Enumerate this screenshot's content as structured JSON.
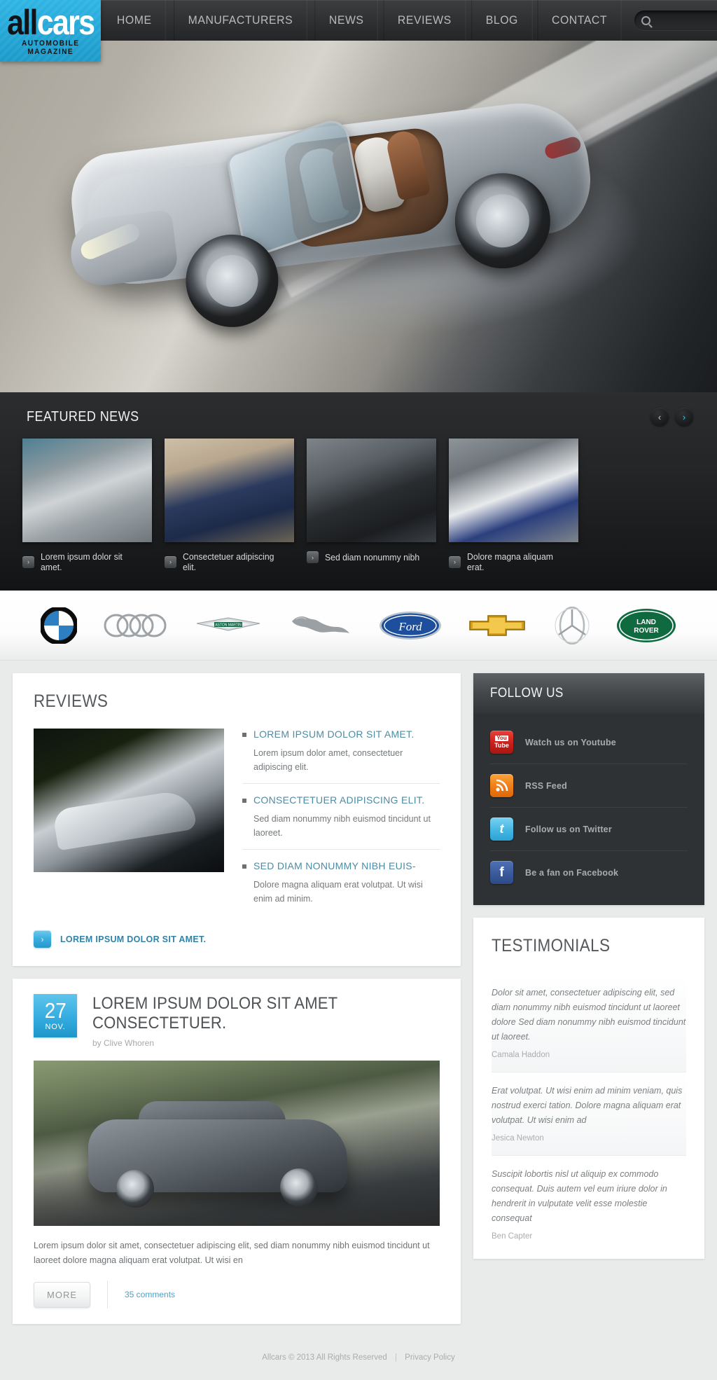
{
  "site": {
    "logo_primary": "all",
    "logo_secondary": "cars",
    "logo_tagline": "AUTOMOBILE MAGAZINE",
    "accent_color": "#29a8d6",
    "link_color": "#4e8ba3"
  },
  "nav": {
    "items": [
      {
        "label": "HOME"
      },
      {
        "label": "MANUFACTURERS"
      },
      {
        "label": "NEWS"
      },
      {
        "label": "REVIEWS"
      },
      {
        "label": "BLOG"
      },
      {
        "label": "CONTACT"
      }
    ],
    "search": {
      "placeholder": "",
      "value": "",
      "icon": "search-icon"
    }
  },
  "featured": {
    "title": "FEATURED NEWS",
    "prev_icon": "‹",
    "next_icon": "›",
    "item_icon": "›",
    "items": [
      {
        "caption": "Lorem ipsum dolor sit amet."
      },
      {
        "caption": "Consectetuer adipiscing elit."
      },
      {
        "caption": "Sed diam nonummy nibh"
      },
      {
        "caption": "Dolore magna aliquam erat."
      }
    ]
  },
  "brands": [
    {
      "name": "BMW"
    },
    {
      "name": "Audi"
    },
    {
      "name": "Aston Martin"
    },
    {
      "name": "Jaguar"
    },
    {
      "name": "Ford"
    },
    {
      "name": "Chevrolet"
    },
    {
      "name": "Mercedes-Benz"
    },
    {
      "name": "Land Rover"
    }
  ],
  "reviews": {
    "title": "REVIEWS",
    "items": [
      {
        "title": "LOREM IPSUM DOLOR SIT AMET.",
        "description": "Lorem ipsum dolor amet, consectetuer adipiscing elit."
      },
      {
        "title": "CONSECTETUER ADIPISCING ELIT.",
        "description": "Sed diam nonummy nibh euismod tincidunt ut laoreet."
      },
      {
        "title": "SED DIAM NONUMMY NIBH EUIS-",
        "description": "Dolore magna aliquam erat volutpat. Ut wisi enim ad minim."
      }
    ],
    "more_label": "LOREM IPSUM DOLOR SIT AMET.",
    "more_icon": "›"
  },
  "post": {
    "date_day": "27",
    "date_month": "NOV.",
    "title": "LOREM IPSUM DOLOR SIT AMET CONSECTETUER.",
    "author": "by Clive Whoren",
    "body": "Lorem ipsum dolor sit amet, consectetuer adipiscing elit, sed diam nonummy nibh euismod tincidunt ut laoreet dolore magna aliquam erat volutpat. Ut wisi en",
    "more_label": "MORE",
    "comments_label": "35 comments"
  },
  "follow": {
    "title": "FOLLOW US",
    "items": [
      {
        "label": "Watch us on Youtube",
        "icon": "youtube-icon"
      },
      {
        "label": "RSS Feed",
        "icon": "rss-icon"
      },
      {
        "label": "Follow us on Twitter",
        "icon": "twitter-icon"
      },
      {
        "label": "Be a fan on Facebook",
        "icon": "facebook-icon"
      }
    ]
  },
  "testimonials": {
    "title": "TESTIMONIALS",
    "items": [
      {
        "quote": "Dolor sit amet, consectetuer adipiscing elit, sed diam nonummy nibh euismod tincidunt ut laoreet dolore Sed diam nonummy nibh euismod tincidunt ut laoreet.",
        "author": "Camala Haddon"
      },
      {
        "quote": "Erat volutpat. Ut wisi enim ad minim veniam, quis nostrud exerci tation. Dolore magna aliquam erat volutpat. Ut wisi enim ad",
        "author": "Jesica Newton"
      },
      {
        "quote": "Suscipit lobortis nisl ut aliquip ex commodo consequat. Duis autem vel eum iriure dolor in hendrerit in vulputate velit esse molestie consequat",
        "author": "Ben Capter"
      }
    ]
  },
  "footer": {
    "copyright": "Allcars © 2013 All Rights Reserved",
    "separator": "|",
    "privacy_label": "Privacy Policy"
  }
}
